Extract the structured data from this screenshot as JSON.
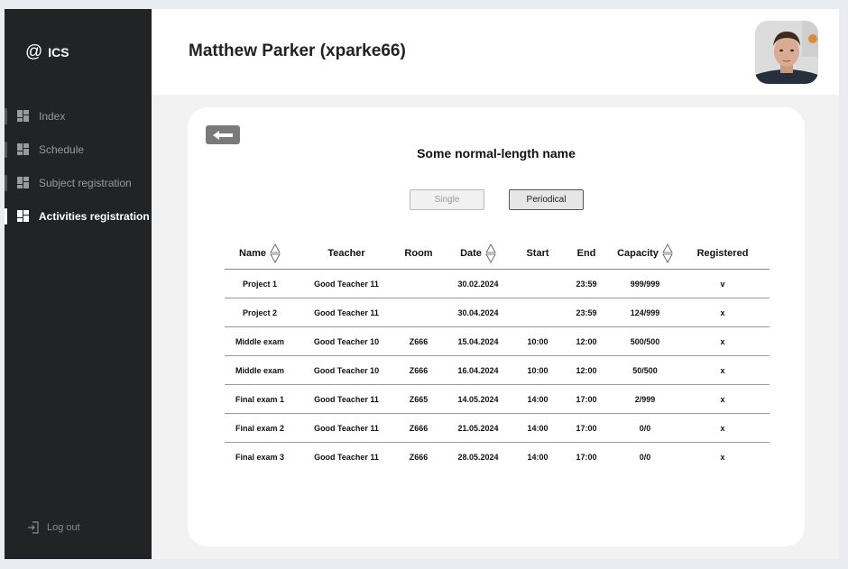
{
  "app": {
    "logo_text": "ICS",
    "logo_symbol": "@"
  },
  "sidebar": {
    "items": [
      {
        "label": "Index",
        "icon": "dashboard-icon"
      },
      {
        "label": "Schedule",
        "icon": "dashboard-icon"
      },
      {
        "label": "Subject registration",
        "icon": "dashboard-icon"
      },
      {
        "label": "Activities registration",
        "icon": "dashboard-icon",
        "active": true
      }
    ],
    "logout_label": "Log out"
  },
  "header": {
    "user_name": "Matthew Parker (xparke66)"
  },
  "main": {
    "title": "Some normal-length name",
    "toggle_single": "Single",
    "toggle_periodical": "Periodical",
    "selected_mode": "Periodical",
    "columns": [
      "Name",
      "Teacher",
      "Room",
      "Date",
      "Start",
      "End",
      "Capacity",
      "Registered"
    ],
    "rows": [
      [
        "Project 1",
        "Good Teacher 11",
        "",
        "30.02.2024",
        "",
        "23:59",
        "999/999",
        "v"
      ],
      [
        "Project 2",
        "Good Teacher 11",
        "",
        "30.04.2024",
        "",
        "23:59",
        "124/999",
        "x"
      ],
      [
        "Middle exam",
        "Good Teacher 10",
        "Z666",
        "15.04.2024",
        "10:00",
        "12:00",
        "500/500",
        "x"
      ],
      [
        "Middle exam",
        "Good Teacher 10",
        "Z666",
        "16.04.2024",
        "10:00",
        "12:00",
        "50/500",
        "x"
      ],
      [
        "Final exam 1",
        "Good Teacher 11",
        "Z665",
        "14.05.2024",
        "14:00",
        "17:00",
        "2/999",
        "x"
      ],
      [
        "Final exam 2",
        "Good Teacher 11",
        "Z666",
        "21.05.2024",
        "14:00",
        "17:00",
        "0/0",
        "x"
      ],
      [
        "Final exam 3",
        "Good Teacher 11",
        "Z666",
        "28.05.2024",
        "14:00",
        "17:00",
        "0/0",
        "x"
      ]
    ]
  },
  "colors": {
    "sidebar_bg": "#222324",
    "page_bg": "#f2f2f2",
    "card_bg": "#ffffff",
    "back_button": "#7a7a7a"
  }
}
